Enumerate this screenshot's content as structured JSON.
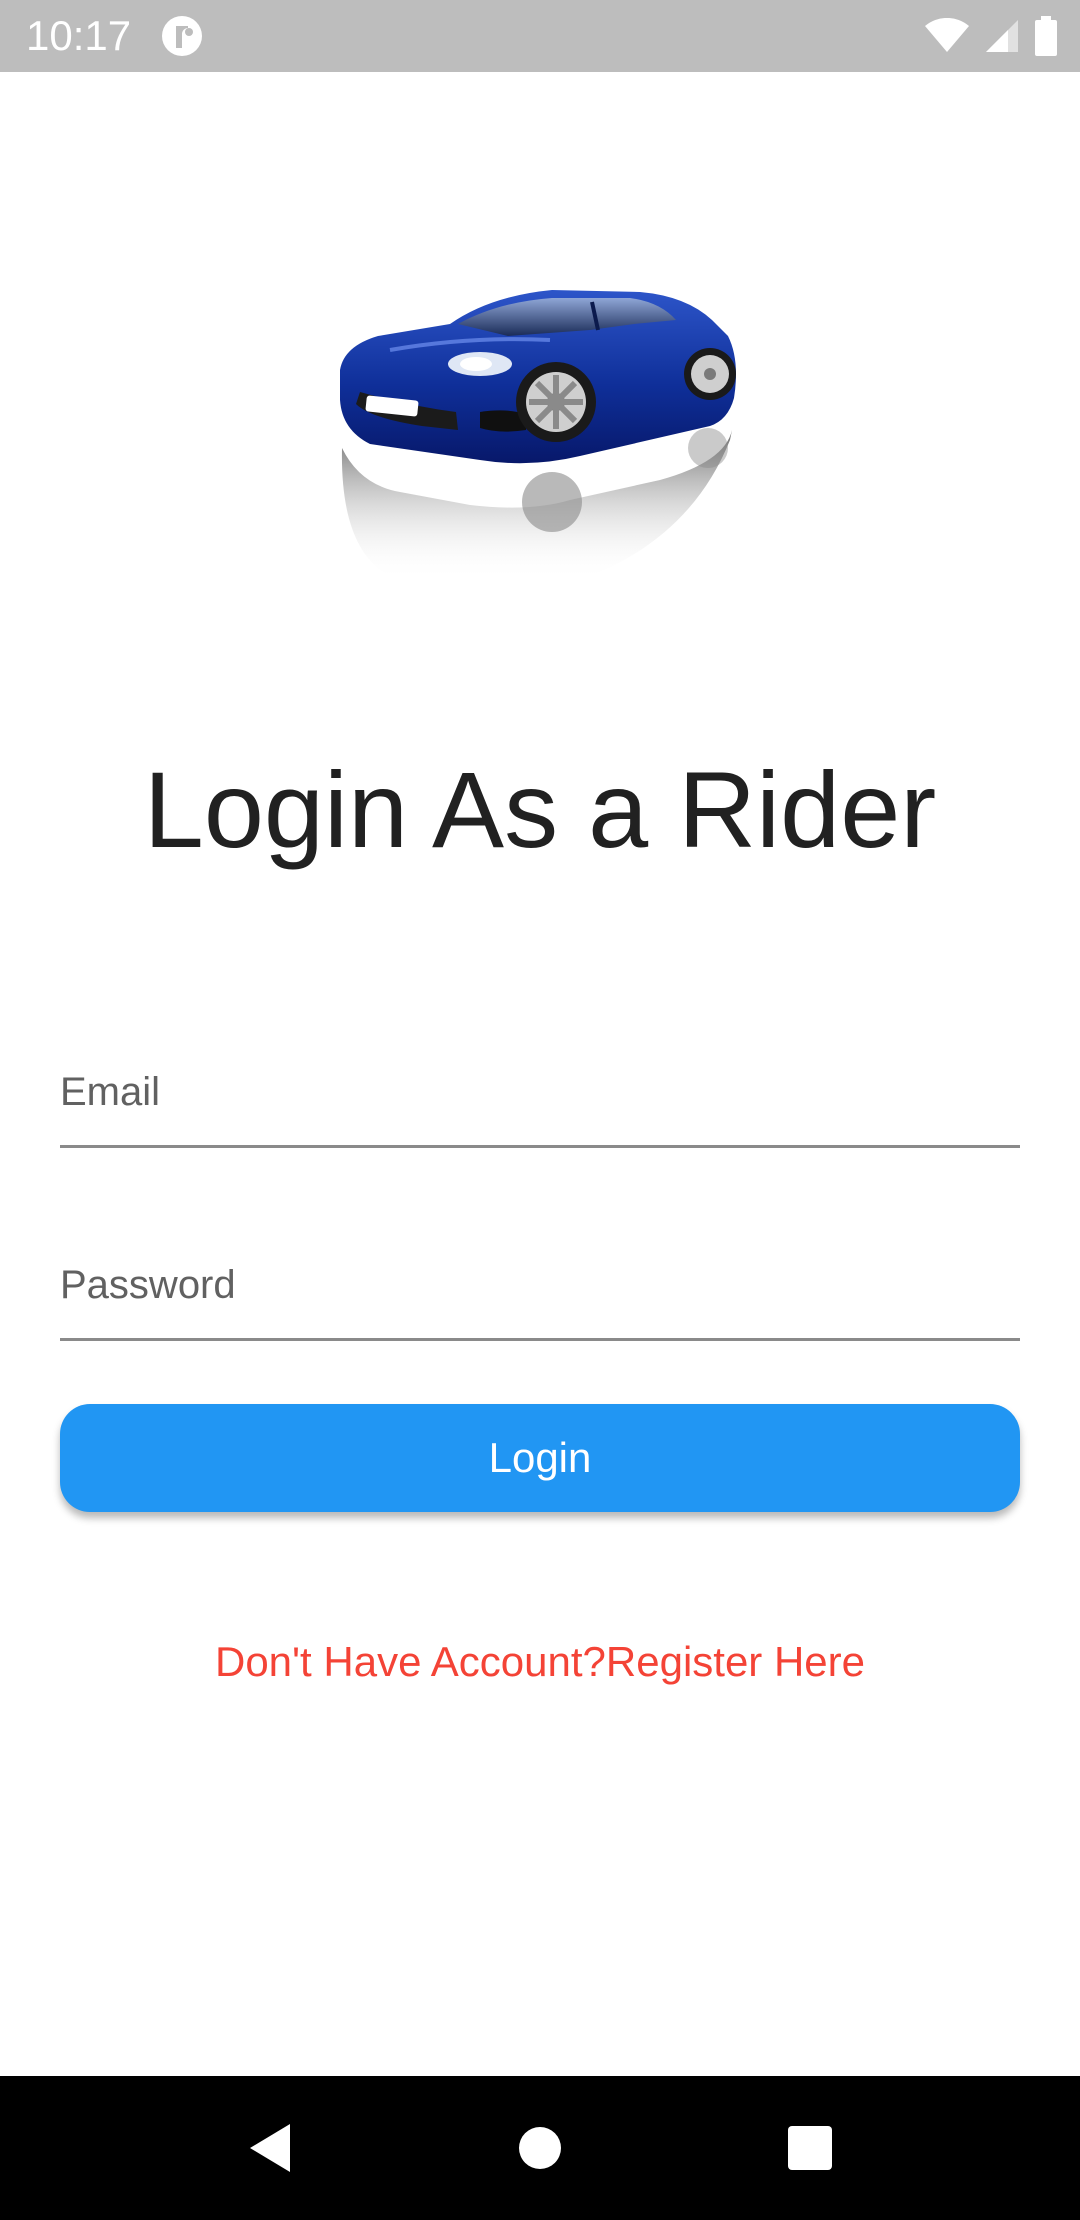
{
  "status_bar": {
    "time": "10:17",
    "app_icon": "notification-app-icon",
    "icons": [
      "wifi-icon",
      "cellular-signal-icon",
      "battery-icon"
    ]
  },
  "hero": {
    "image": "blue-sports-car-illustration"
  },
  "title": "Login As a Rider",
  "form": {
    "email_placeholder": "Email",
    "email_value": "",
    "password_placeholder": "Password",
    "password_value": "",
    "login_label": "Login"
  },
  "register_link": "Don't Have Account?Register Here",
  "colors": {
    "primary": "#2196f3",
    "link": "#f44336",
    "title": "#212121",
    "status_bar": "#bdbdbd",
    "nav_bar": "#000000"
  },
  "nav_bar": {
    "buttons": [
      "back-icon",
      "home-icon",
      "recents-icon"
    ]
  }
}
